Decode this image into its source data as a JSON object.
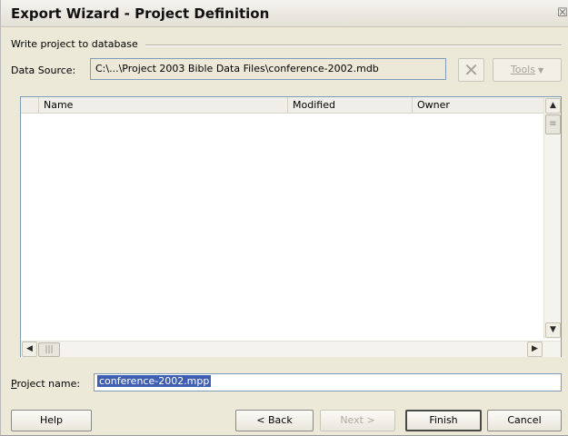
{
  "window": {
    "title": "Export Wizard - Project Definition",
    "close_glyph": "☒"
  },
  "group": {
    "label": "Write project to database"
  },
  "data_source": {
    "label": "Data Source:",
    "value": "C:\\...\\Project 2003 Bible Data Files\\conference-2002.mdb"
  },
  "delete_button": {
    "glyph": "✕",
    "enabled": false,
    "icon": "close-x-icon"
  },
  "tools_button": {
    "label": "Tools",
    "arrow": "▼",
    "enabled": false
  },
  "list": {
    "columns": [
      "Name",
      "Modified",
      "Owner"
    ],
    "rows": []
  },
  "scrollbars": {
    "up": "▲",
    "down": "▼",
    "left": "◀",
    "right": "▶",
    "v_grip": "≡",
    "h_grip": "|||"
  },
  "project_name": {
    "label_prefix": "P",
    "label_rest": "roject name:",
    "value": "conference-2002.mpp"
  },
  "buttons": {
    "help": "Help",
    "back": "< Back",
    "next": "Next >",
    "finish": "Finish",
    "cancel": "Cancel"
  },
  "colors": {
    "dialog_bg": "#ece9d8",
    "selection": "#3f5fb3",
    "field_border": "#7f9db9"
  }
}
